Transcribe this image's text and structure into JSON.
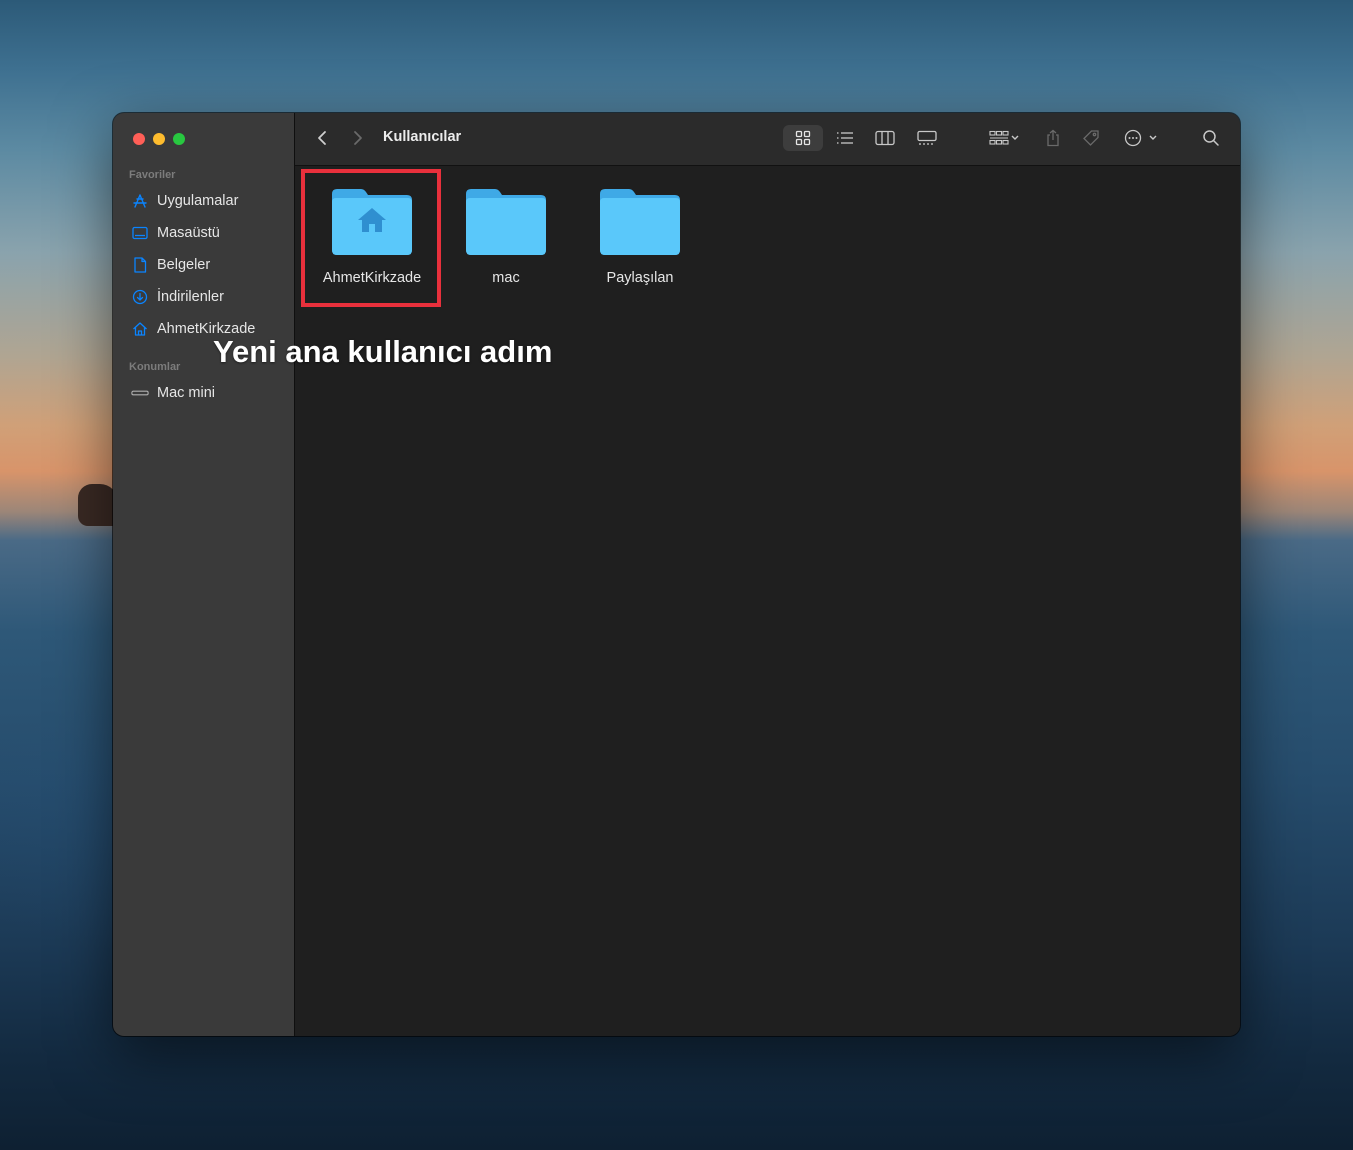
{
  "window": {
    "path_title": "Kullanıcılar"
  },
  "sidebar": {
    "favorites_header": "Favoriler",
    "favorites": [
      {
        "label": "Uygulamalar",
        "icon": "applications-icon"
      },
      {
        "label": "Masaüstü",
        "icon": "desktop-icon"
      },
      {
        "label": "Belgeler",
        "icon": "document-icon"
      },
      {
        "label": "İndirilenler",
        "icon": "downloads-icon"
      },
      {
        "label": "AhmetKirkzade",
        "icon": "home-icon"
      }
    ],
    "locations_header": "Konumlar",
    "locations": [
      {
        "label": "Mac mini",
        "icon": "mac-mini-icon"
      }
    ]
  },
  "toolbar": {
    "back": "chevron-left-icon",
    "forward": "chevron-right-icon",
    "views": [
      "icon-view-icon",
      "list-view-icon",
      "column-view-icon",
      "gallery-view-icon"
    ],
    "selected_view": "icon-view-icon",
    "actions": [
      "group-icon",
      "share-icon",
      "tag-icon",
      "more-icon",
      "search-icon"
    ]
  },
  "folders": [
    {
      "label": "AhmetKirkzade",
      "icon": "home-folder-icon",
      "highlighted": true
    },
    {
      "label": "mac",
      "icon": "folder-icon"
    },
    {
      "label": "Paylaşılan",
      "icon": "folder-icon"
    }
  ],
  "annotation": {
    "text": "Yeni ana kullanıcı adım"
  },
  "colors": {
    "accent": "#0a84ff",
    "folder": "#5ac8fa",
    "highlight_border": "#e8303c",
    "close": "#ff5f57",
    "minimize": "#febc2e",
    "zoom": "#28c840"
  }
}
